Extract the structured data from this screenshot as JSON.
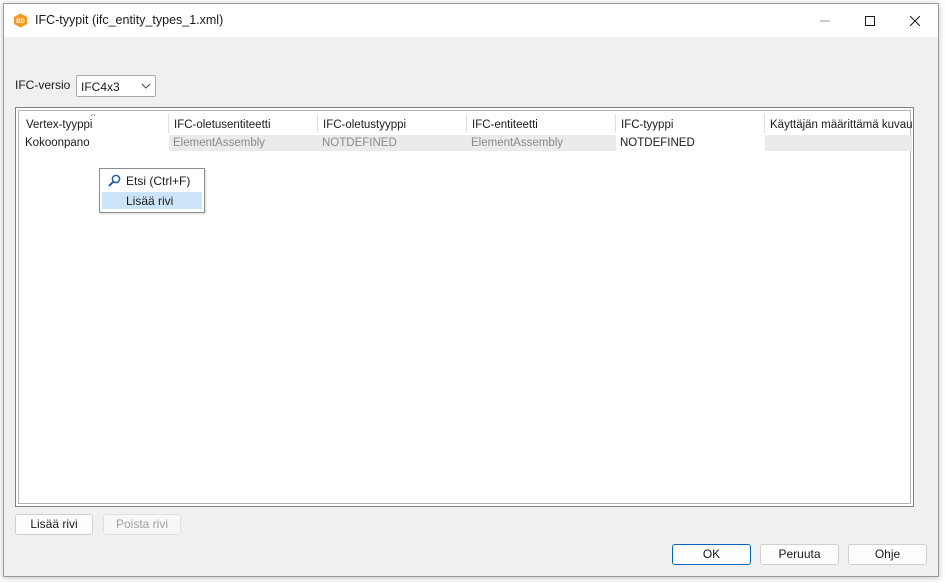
{
  "window": {
    "title": "IFC-tyypit (ifc_entity_types_1.xml)",
    "app_icon_text": "BD",
    "accent_color": "#f29a1d"
  },
  "version": {
    "label": "IFC-versio",
    "selected": "IFC4x3"
  },
  "grid": {
    "columns": [
      "Vertex-tyyppi",
      "IFC-oletusentiteetti",
      "IFC-oletustyyppi",
      "IFC-entiteetti",
      "IFC-tyyppi",
      "Käyttäjän määrittämä kuvaus"
    ],
    "rows": [
      [
        "Kokoonpano",
        "ElementAssembly",
        "NOTDEFINED",
        "ElementAssembly",
        "NOTDEFINED",
        ""
      ]
    ]
  },
  "context_menu": {
    "items": [
      {
        "label": "Etsi (Ctrl+F)",
        "icon": "search-icon"
      },
      {
        "label": "Lisää rivi",
        "highlighted": true
      }
    ]
  },
  "buttons": {
    "add_row": "Lisää rivi",
    "remove_row": "Poista rivi",
    "ok": "OK",
    "cancel": "Peruuta",
    "help": "Ohje"
  }
}
